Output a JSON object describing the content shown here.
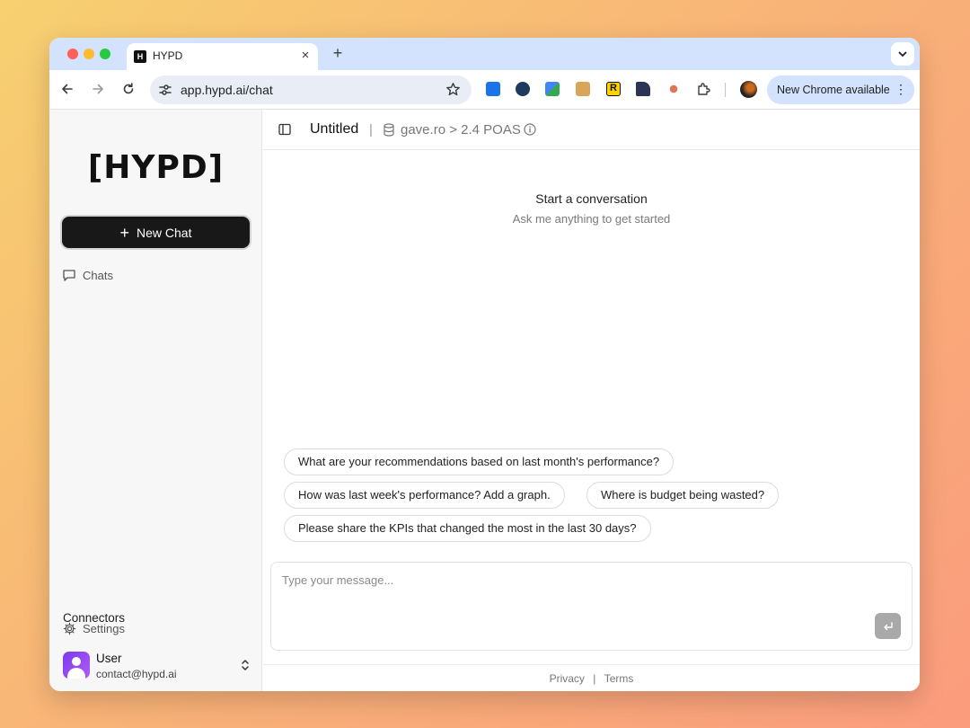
{
  "browser": {
    "tab_title": "HYPD",
    "tab_favicon_letter": "H",
    "url": "app.hypd.ai/chat",
    "update_label": "New Chrome available",
    "extensions": [
      "reading-list-icon",
      "tracker-icon",
      "translate-icon",
      "toolbox-icon",
      "r-extension-icon",
      "library-icon",
      "claude-icon",
      "puzzle-icon"
    ]
  },
  "sidebar": {
    "logo": "[HYPD]",
    "new_chat_label": "New Chat",
    "chats_label": "Chats",
    "settings_label": "Settings",
    "connectors_label": "Connectors",
    "user": {
      "name": "User",
      "email": "contact@hypd.ai"
    }
  },
  "header": {
    "title": "Untitled",
    "separator": "|",
    "context": "gave.ro > 2.4 POAS"
  },
  "empty_state": {
    "title": "Start a conversation",
    "subtitle": "Ask me anything to get started"
  },
  "suggestions": [
    "What are your recommendations based on last month's performance?",
    "How was last week's performance? Add a graph.",
    "Where is budget being wasted?",
    "Please share the KPIs that changed the most in the last 30 days?"
  ],
  "composer": {
    "placeholder": "Type your message..."
  },
  "footer": {
    "privacy": "Privacy",
    "separator": "|",
    "terms": "Terms"
  },
  "colors": {
    "accent": "#181818",
    "tabstrip": "#d3e3fd",
    "avatar": "#7c3aed"
  }
}
